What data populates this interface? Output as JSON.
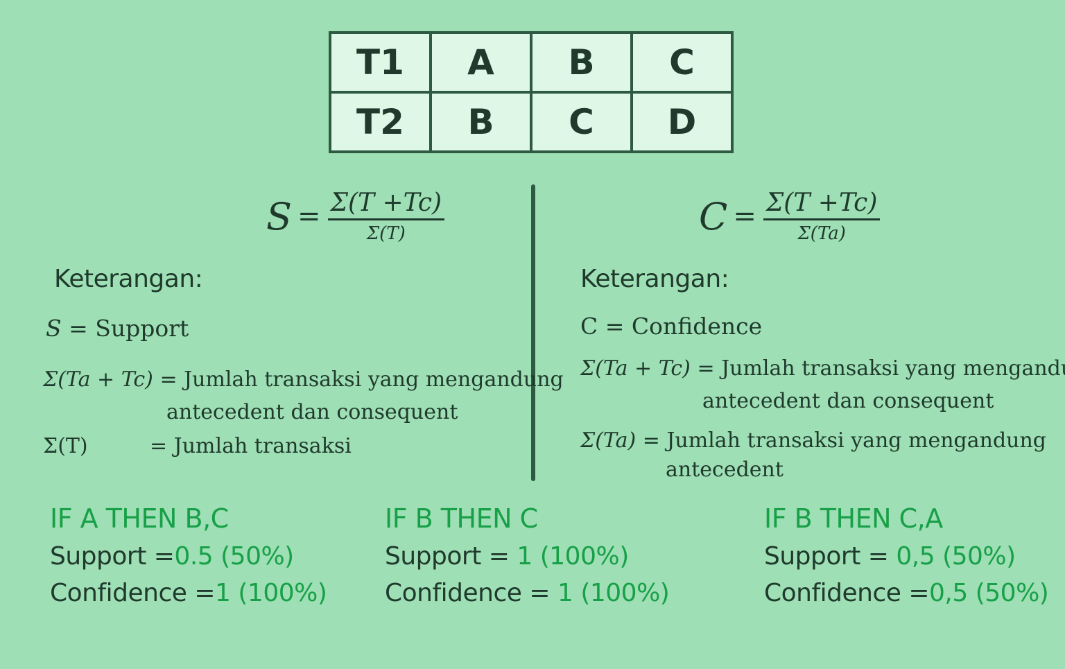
{
  "table": {
    "rows": [
      [
        "T1",
        "A",
        "B",
        "C"
      ],
      [
        "T2",
        "B",
        "C",
        "D"
      ]
    ]
  },
  "support_formula": {
    "lhs": "S",
    "eq": "=",
    "numerator": "Σ(T +Tc)",
    "denominator": "Σ(T)"
  },
  "confidence_formula": {
    "lhs": "C",
    "eq": "=",
    "numerator": "Σ(T +Tc)",
    "denominator": "Σ(Ta)"
  },
  "left_legend": {
    "heading": "Keterangan:",
    "s_symbol": "S",
    "s_text": "= Support",
    "sum_tatc_symbol": "Σ(Ta + Tc)",
    "sum_tatc_text": "= Jumlah transaksi yang mengandung",
    "sum_tatc_text2": "antecedent dan consequent",
    "sum_t_symbol": "Σ(T)",
    "sum_t_text": "= Jumlah transaksi"
  },
  "right_legend": {
    "heading": "Keterangan:",
    "c_line": "C = Confidence",
    "sum_tatc_symbol": "Σ(Ta + Tc)",
    "sum_tatc_text": "= Jumlah transaksi yang mengandung",
    "sum_tatc_text2": "antecedent dan consequent",
    "sum_ta_symbol": "Σ(Ta)",
    "sum_ta_text": "= Jumlah transaksi yang mengandung",
    "sum_ta_text2": "antecedent"
  },
  "rules": [
    {
      "title": "IF A THEN B,C",
      "support_label": "Support =",
      "support_value": "0.5 (50%)",
      "confidence_label": "Confidence =",
      "confidence_value": "1 (100%)"
    },
    {
      "title": "IF B THEN C",
      "support_label": "Support =",
      "support_value": "1 (100%)",
      "confidence_label": "Confidence =",
      "confidence_value": "1 (100%)"
    },
    {
      "title": "IF B THEN C,A",
      "support_label": "Support =",
      "support_value": "0,5 (50%)",
      "confidence_label": "Confidence =",
      "confidence_value": "0,5 (50%)"
    }
  ],
  "colors": {
    "background": "#9edfb5",
    "table_fill": "#def7e6",
    "table_border": "#2d5a40",
    "text": "#1f3a2c",
    "accent_green": "#18a048"
  }
}
